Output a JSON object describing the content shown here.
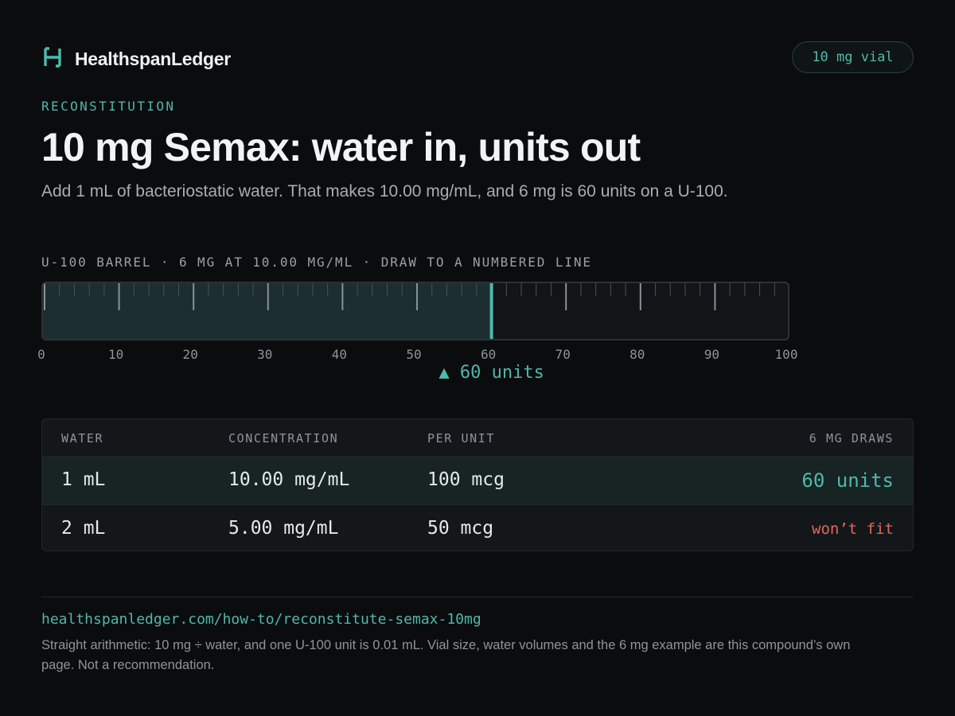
{
  "brand": {
    "name": "HealthspanLedger",
    "logo_icon": "h-bracket-logo-icon"
  },
  "vial_badge": "10 mg vial",
  "eyebrow": "RECONSTITUTION",
  "title": "10 mg Semax: water in, units out",
  "subtitle": "Add 1 mL of bacteriostatic water. That makes 10.00 mg/mL, and 6 mg is 60 units on a U-100.",
  "barrel": {
    "caption": "U-100 BARREL · 6 MG AT 10.00 MG/ML · DRAW TO A NUMBERED LINE",
    "scale_labels": [
      "0",
      "10",
      "20",
      "30",
      "40",
      "50",
      "60",
      "70",
      "80",
      "90",
      "100"
    ],
    "max_units": 100,
    "fill_units": 60,
    "marker_label": "▲ 60 units"
  },
  "table": {
    "headers": [
      "WATER",
      "CONCENTRATION",
      "PER UNIT",
      "6 MG DRAWS"
    ],
    "rows": [
      {
        "water": "1 mL",
        "concentration": "10.00 mg/mL",
        "per_unit": "100 mcg",
        "draws": "60 units",
        "fits": true
      },
      {
        "water": "2 mL",
        "concentration": "5.00 mg/mL",
        "per_unit": "50 mcg",
        "draws": "won’t fit",
        "fits": false
      }
    ]
  },
  "footer": {
    "link": "healthspanledger.com/how-to/reconstitute-semax-10mg",
    "note": "Straight arithmetic: 10 mg ÷ water, and one U-100 unit is 0.01 mL. Vial size, water volumes and the 6 mg example are this compound’s own page. Not a recommendation."
  },
  "colors": {
    "accent": "#4fb8ad",
    "warning": "#e0675c",
    "background": "#0b0c0e"
  }
}
